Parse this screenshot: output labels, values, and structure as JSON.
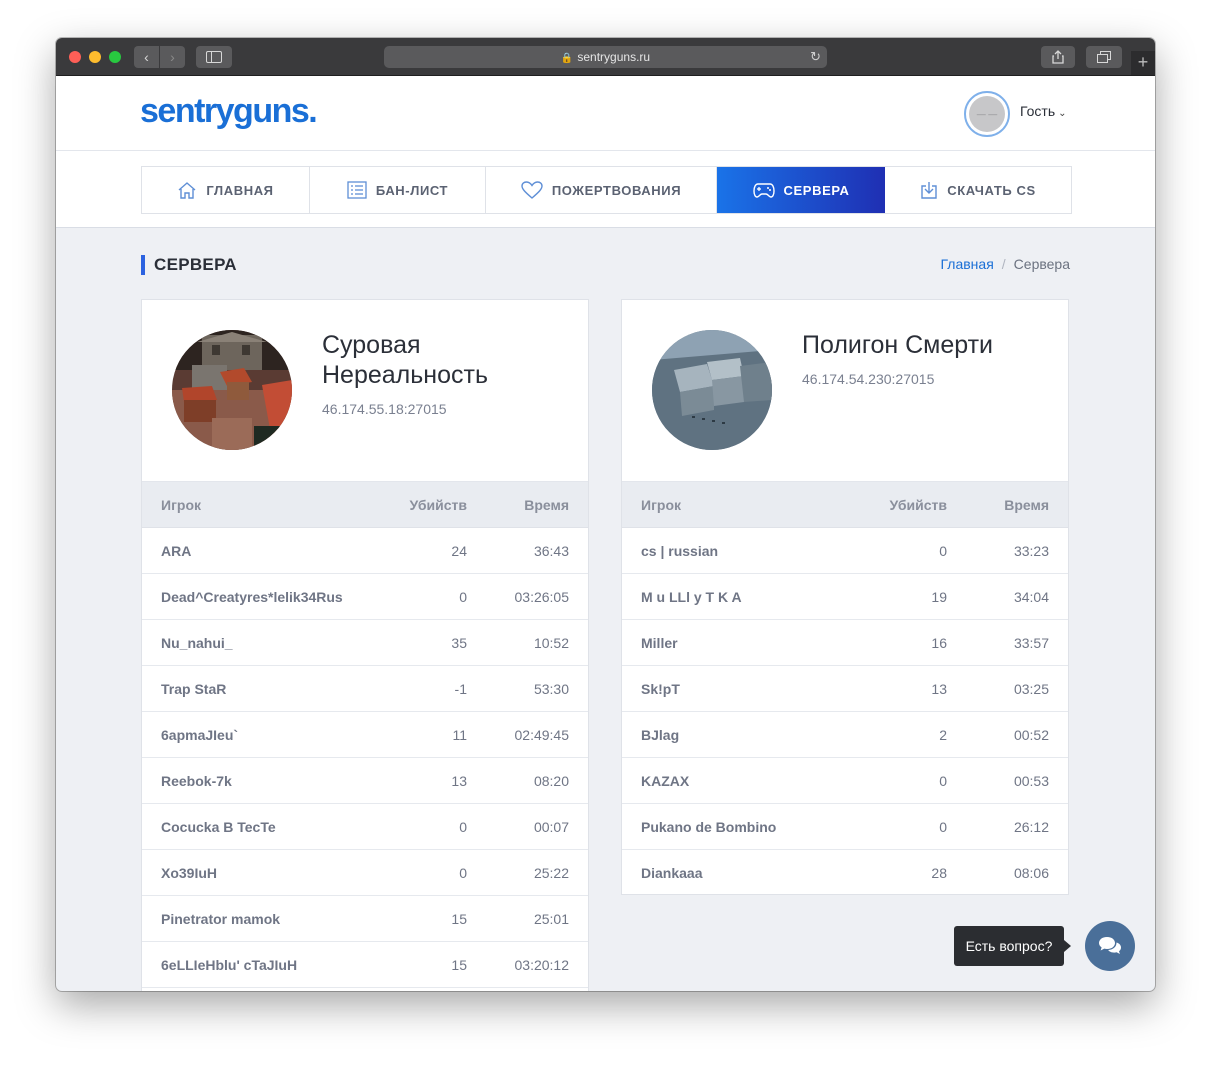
{
  "browser": {
    "url": "sentryguns.ru"
  },
  "header": {
    "logo": "sentryguns.",
    "user_name": "Гость"
  },
  "nav": {
    "items": [
      {
        "label": "ГЛАВНАЯ",
        "icon": "home-icon"
      },
      {
        "label": "БАН-ЛИСТ",
        "icon": "list-icon"
      },
      {
        "label": "ПОЖЕРТВОВАНИЯ",
        "icon": "heart-icon"
      },
      {
        "label": "СЕРВЕРА",
        "icon": "gamepad-icon",
        "active": true
      },
      {
        "label": "СКАЧАТЬ CS",
        "icon": "download-icon"
      }
    ]
  },
  "page": {
    "title": "СЕРВЕРА",
    "breadcrumb": {
      "home": "Главная",
      "current": "Сервера"
    }
  },
  "table_headers": {
    "player": "Игрок",
    "kills": "Убийств",
    "time": "Время"
  },
  "servers": [
    {
      "name": "Суровая Нереальность",
      "address": "46.174.55.18:27015",
      "players": [
        {
          "name": "ARA",
          "kills": "24",
          "time": "36:43"
        },
        {
          "name": "Dead^Creatyres*lelik34Rus",
          "kills": "0",
          "time": "03:26:05"
        },
        {
          "name": "Nu_nahui_",
          "kills": "35",
          "time": "10:52"
        },
        {
          "name": "Trap StaR",
          "kills": "-1",
          "time": "53:30"
        },
        {
          "name": "6apmaJIeu`",
          "kills": "11",
          "time": "02:49:45"
        },
        {
          "name": "Reebok-7k",
          "kills": "13",
          "time": "08:20"
        },
        {
          "name": "Cocucka B TecTe",
          "kills": "0",
          "time": "00:07"
        },
        {
          "name": "Xo39IuH",
          "kills": "0",
          "time": "25:22"
        },
        {
          "name": "Pinetrator mamok",
          "kills": "15",
          "time": "25:01"
        },
        {
          "name": "6eLLIeHblu' cTaJIuH",
          "kills": "15",
          "time": "03:20:12"
        }
      ]
    },
    {
      "name": "Полигон Смерти",
      "address": "46.174.54.230:27015",
      "players": [
        {
          "name": "cs | russian",
          "kills": "0",
          "time": "33:23"
        },
        {
          "name": "M u LLl y T K A",
          "kills": "19",
          "time": "34:04"
        },
        {
          "name": "Miller",
          "kills": "16",
          "time": "33:57"
        },
        {
          "name": "Sk!pT",
          "kills": "13",
          "time": "03:25"
        },
        {
          "name": "BJlag",
          "kills": "2",
          "time": "00:52"
        },
        {
          "name": "KAZAX",
          "kills": "0",
          "time": "00:53"
        },
        {
          "name": "Pukano de Bombino",
          "kills": "0",
          "time": "26:12"
        },
        {
          "name": "Diankaaa",
          "kills": "28",
          "time": "08:06"
        }
      ]
    }
  ],
  "chat": {
    "tooltip": "Есть вопрос?",
    "icon": "chat-bubbles-icon"
  },
  "colors": {
    "brand": "#1a6fd6",
    "nav_active_from": "#1a73e8",
    "nav_active_to": "#1f2fb3",
    "chat_button": "#4a6f99"
  }
}
